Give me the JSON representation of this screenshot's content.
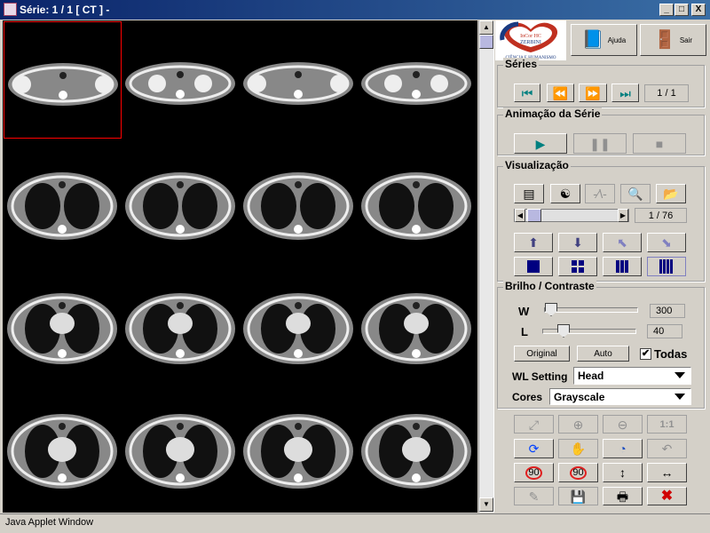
{
  "window": {
    "title": "Série: 1 / 1 [ CT ] -",
    "controls": [
      "_",
      "□",
      "X"
    ]
  },
  "viewer": {
    "rows": 4,
    "cols": 4,
    "selected_index": 0,
    "selection_color": "#ff0000"
  },
  "logo": {
    "line1": "InCor HC",
    "line2": "Zerbini",
    "tagline": "Ciência e Humanismo"
  },
  "header": {
    "help_label": "Ajuda",
    "exit_label": "Sair"
  },
  "series": {
    "title": "Séries",
    "counter": "1 / 1"
  },
  "animation": {
    "title": "Animação da Série"
  },
  "view": {
    "title": "Visualização",
    "image_counter": "1 / 76",
    "scroll_position": 0.0
  },
  "brightness": {
    "title": "Brilho / Contraste",
    "w_label": "W",
    "w_value": "300",
    "l_label": "L",
    "l_value": "40",
    "original_label": "Original",
    "auto_label": "Auto",
    "todas_label": "Todas",
    "todas_checked": true,
    "wl_label": "WL Setting",
    "wl_value": "Head",
    "cores_label": "Cores",
    "cores_value": "Grayscale"
  },
  "tools": {
    "one_to_one": "1:1",
    "rotate": "90"
  },
  "status": {
    "text": "Java Applet Window"
  }
}
